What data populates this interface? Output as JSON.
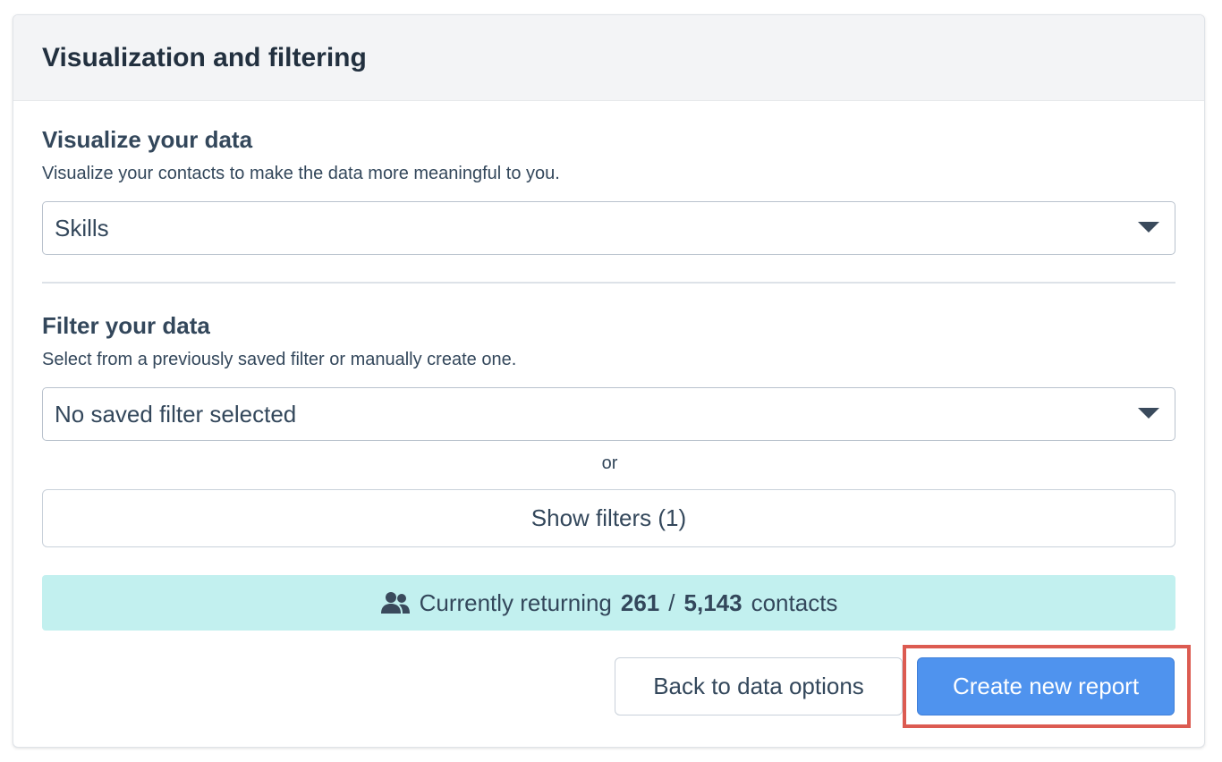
{
  "panel": {
    "title": "Visualization and filtering"
  },
  "visualize": {
    "heading": "Visualize your data",
    "description": "Visualize your contacts to make the data more meaningful to you.",
    "selected_value": "Skills"
  },
  "filter": {
    "heading": "Filter your data",
    "description": "Select from a previously saved filter or manually create one.",
    "saved_filter_value": "No saved filter selected",
    "or_label": "or",
    "show_filters_label": "Show filters (1)"
  },
  "results": {
    "prefix": "Currently returning",
    "returned": "261",
    "separator": "/",
    "total": "5,143",
    "suffix": "contacts"
  },
  "actions": {
    "back_label": "Back to data options",
    "create_label": "Create new report"
  },
  "colors": {
    "primary_button": "#4f93ee",
    "results_bar": "#c2f0ef",
    "highlight": "#dc5b51",
    "header_bg": "#f3f4f6"
  },
  "icons": {
    "results_icon": "people-icon",
    "select_caret": "caret-down-icon"
  }
}
